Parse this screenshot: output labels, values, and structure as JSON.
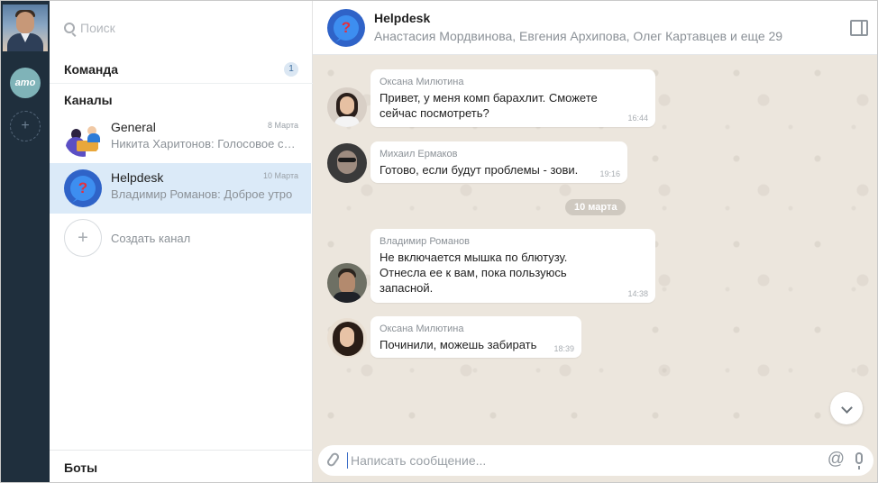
{
  "search": {
    "placeholder": "Поиск"
  },
  "sidebar": {
    "team_label": "Команда",
    "team_count": "1",
    "channels_label": "Каналы",
    "channels": [
      {
        "name": "General",
        "date": "8 Марта",
        "preview": "Никита Харитонов: Голосовое сообщение"
      },
      {
        "name": "Helpdesk",
        "date": "10 Марта",
        "preview": "Владимир Романов: Доброе утро",
        "active": true
      }
    ],
    "create_label": "Создать канал",
    "bots_label": "Боты"
  },
  "rail": {
    "workspace_badge": "amo"
  },
  "chat": {
    "title": "Helpdesk",
    "members": "Анастасия Мордвинова, Евгения Архипова, Олег Картавцев и еще 29",
    "messages": [
      {
        "author": "Оксана Милютина",
        "text": "Привет, у меня комп барахлит. Сможете сейчас посмотреть?",
        "time": "16:44"
      },
      {
        "author": "Михаил Ермаков",
        "text": "Готово, если будут проблемы - зови.",
        "time": "19:16"
      },
      {
        "author": "Владимир Романов",
        "text": "Не включается мышка по блютузу. Отнесла ее к вам, пока пользуюсь запасной.",
        "time": "14:38"
      },
      {
        "author": "Оксана Милютина",
        "text": "Починили, можешь забирать",
        "time": "18:39"
      }
    ],
    "date_separator": "10 марта",
    "composer_placeholder": "Написать сообщение...",
    "at_symbol": "@"
  },
  "colors": {
    "rail_bg": "#1f2f3d",
    "active_channel": "#dbeaf8",
    "chat_bg": "#ece6dd",
    "accent": "#3d8ef0"
  }
}
